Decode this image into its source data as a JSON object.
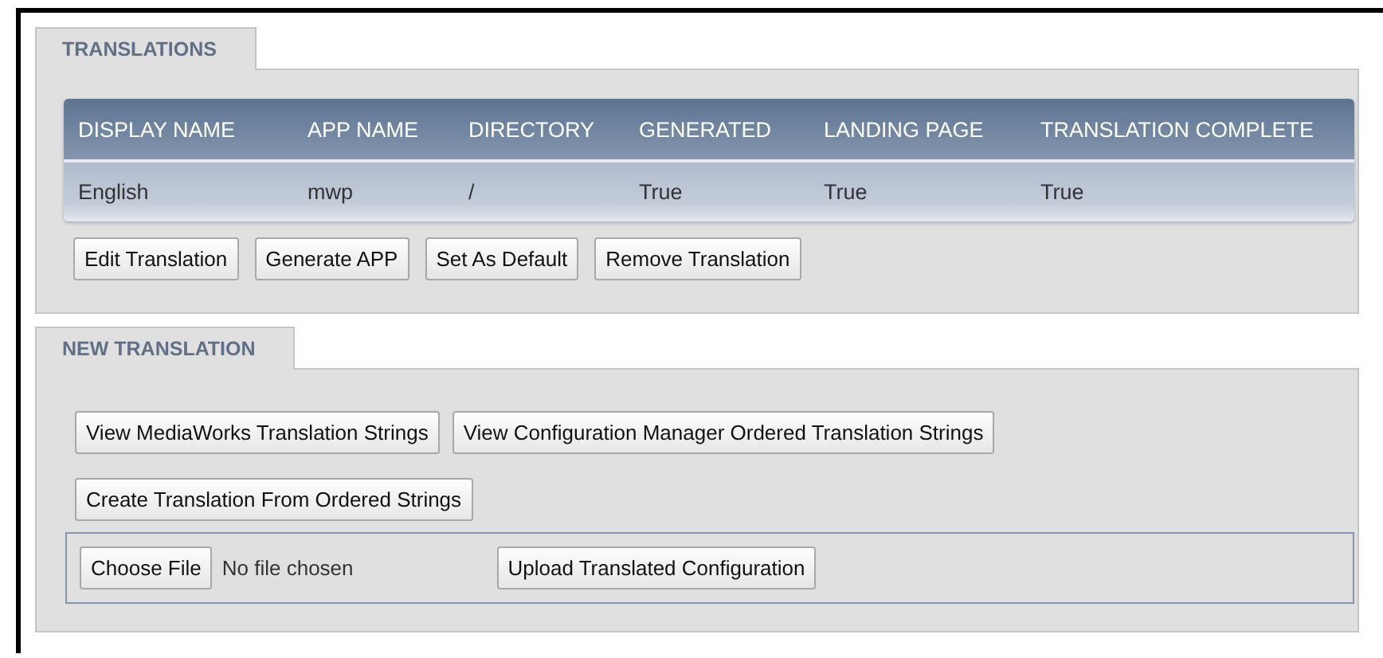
{
  "translations": {
    "tab": "TRANSLATIONS",
    "columns": [
      "DISPLAY NAME",
      "APP NAME",
      "DIRECTORY",
      "GENERATED",
      "LANDING PAGE",
      "TRANSLATION COMPLETE"
    ],
    "rows": [
      [
        "English",
        "mwp",
        "/",
        "True",
        "True",
        "True"
      ]
    ],
    "buttons": [
      "Edit Translation",
      "Generate APP",
      "Set As Default",
      "Remove Translation"
    ]
  },
  "new_translation": {
    "tab": "NEW TRANSLATION",
    "button_rows": [
      [
        "View MediaWorks Translation Strings",
        "View Configuration Manager Ordered Translation Strings"
      ],
      [
        "Create Translation From Ordered Strings"
      ]
    ],
    "file_input": {
      "button": "Choose File",
      "status": "No file chosen"
    },
    "upload_button": "Upload Translated Configuration"
  }
}
